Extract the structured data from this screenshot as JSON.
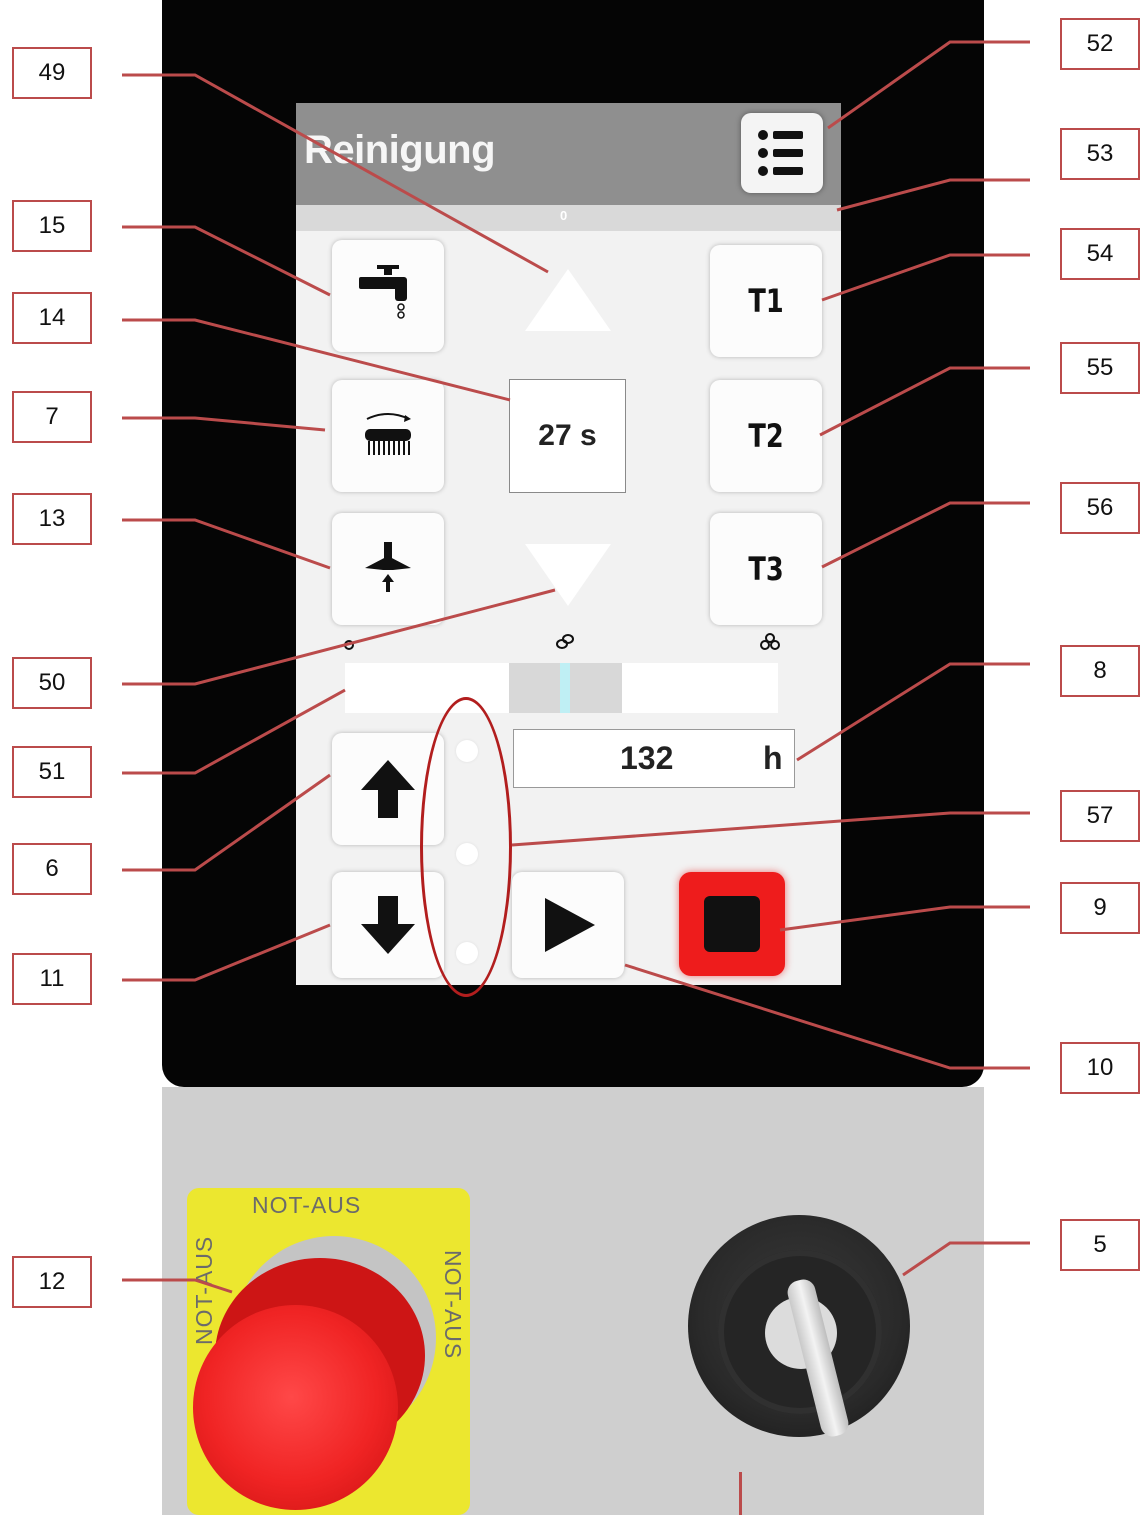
{
  "screen": {
    "title": "Reinigung",
    "status_value": "0",
    "timer_value": "27 s",
    "hours_value": "132",
    "hours_unit": "h",
    "tool_buttons": [
      "T1",
      "T2",
      "T3"
    ]
  },
  "panel": {
    "estop_label": "NOT-AUS"
  },
  "callouts": [
    "49",
    "52",
    "53",
    "15",
    "54",
    "14",
    "55",
    "7",
    "13",
    "56",
    "50",
    "8",
    "51",
    "6",
    "57",
    "9",
    "11",
    "10",
    "12",
    "5"
  ],
  "colors": {
    "callout_line": "#bb4b4b",
    "highlight_ellipse": "#b21e1e",
    "stop_button": "#ee1c1c",
    "estop_plate": "#ece72f",
    "screen_header": "#8f8f8f"
  },
  "icons": [
    "menu-list-icon",
    "water-tap-icon",
    "rotating-brush-icon",
    "spray-nozzle-icon",
    "arrow-up-triangle-icon",
    "arrow-down-triangle-icon",
    "arrow-up-icon",
    "arrow-down-icon",
    "play-icon",
    "stop-icon",
    "level-1-icon",
    "level-2-icon",
    "level-3-icon"
  ]
}
